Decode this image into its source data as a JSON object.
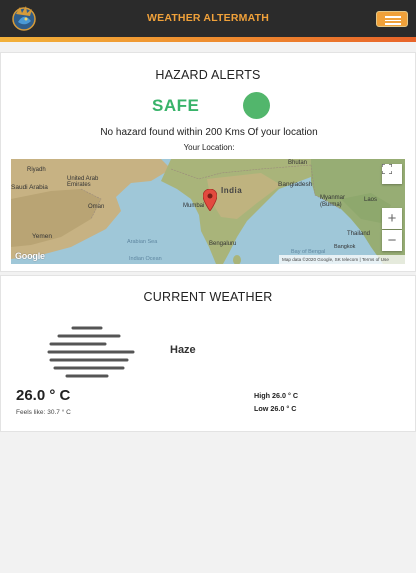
{
  "header": {
    "brand": "WEATHER ALTERMATH",
    "menu_icon": "hamburger-menu-icon",
    "logo_icon": "dragon-logo-icon",
    "colors": {
      "navbar": "#2b2b2b",
      "accent": "#f0a13a",
      "stripe_end": "#e8642a"
    }
  },
  "hazard": {
    "title": "HAZARD ALERTS",
    "status": "SAFE",
    "status_color": "#39b36a",
    "message": "No hazard found within 200 Kms Of your location",
    "location_label": "Your Location:",
    "map": {
      "labels": {
        "riyadh": "Riyadh",
        "uae": "United Arab\nEmirates",
        "saudi": "Saudi Arabia",
        "oman": "Oman",
        "yemen": "Yemen",
        "india": "India",
        "mumbai": "Mumbai",
        "bengaluru": "Bengaluru",
        "bhutan": "Bhutan",
        "bangladesh": "Bangladesh",
        "myanmar": "Myanmar\n(Burma)",
        "laos": "Laos",
        "thailand": "Thailand",
        "bangkok": "Bangkok",
        "bay": "Bay of Bengal",
        "arabian_sea": "Arabian Sea",
        "indian_ocean": "Indian Ocean"
      },
      "attribution": "Map data ©2020 Google, SK telecom | Terms of Use",
      "google": "Google",
      "fullscreen_icon": "fullscreen-icon",
      "zoom_in": "+",
      "zoom_out": "−",
      "marker_icon": "map-marker-icon"
    }
  },
  "weather": {
    "title": "CURRENT WEATHER",
    "condition": "Haze",
    "condition_icon": "haze-icon",
    "temperature": "26.0 ° C",
    "feels_label": "Feels like:",
    "feels_value": "30.7 ° C",
    "high_label": "High",
    "high_value": "26.0 ° C",
    "low_label": "Low",
    "low_value": "26.0 ° C"
  }
}
